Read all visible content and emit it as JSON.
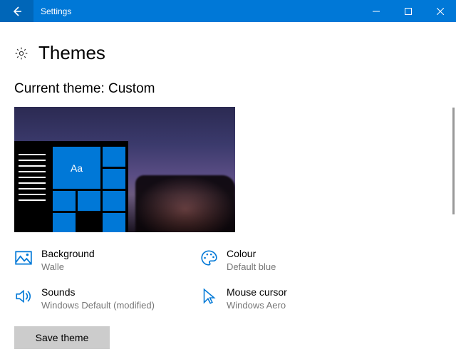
{
  "titlebar": {
    "title": "Settings"
  },
  "page": {
    "heading": "Themes",
    "subheading": "Current theme: Custom"
  },
  "preview": {
    "tile_sample_text": "Aa"
  },
  "settings": {
    "background": {
      "label": "Background",
      "value": "Walle"
    },
    "colour": {
      "label": "Colour",
      "value": "Default blue"
    },
    "sounds": {
      "label": "Sounds",
      "value": "Windows Default (modified)"
    },
    "cursor": {
      "label": "Mouse cursor",
      "value": "Windows Aero"
    }
  },
  "buttons": {
    "save_theme": "Save theme"
  }
}
